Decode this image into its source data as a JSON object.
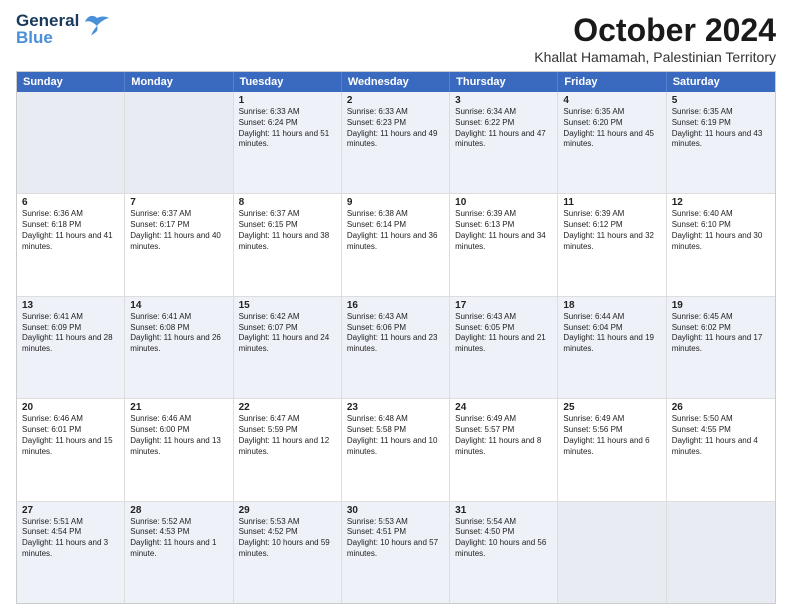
{
  "header": {
    "logo_line1": "General",
    "logo_line2": "Blue",
    "month": "October 2024",
    "location": "Khallat Hamamah, Palestinian Territory"
  },
  "weekdays": [
    "Sunday",
    "Monday",
    "Tuesday",
    "Wednesday",
    "Thursday",
    "Friday",
    "Saturday"
  ],
  "rows": [
    [
      {
        "day": "",
        "info": "",
        "empty": true
      },
      {
        "day": "",
        "info": "",
        "empty": true
      },
      {
        "day": "1",
        "info": "Sunrise: 6:33 AM\nSunset: 6:24 PM\nDaylight: 11 hours and 51 minutes."
      },
      {
        "day": "2",
        "info": "Sunrise: 6:33 AM\nSunset: 6:23 PM\nDaylight: 11 hours and 49 minutes."
      },
      {
        "day": "3",
        "info": "Sunrise: 6:34 AM\nSunset: 6:22 PM\nDaylight: 11 hours and 47 minutes."
      },
      {
        "day": "4",
        "info": "Sunrise: 6:35 AM\nSunset: 6:20 PM\nDaylight: 11 hours and 45 minutes."
      },
      {
        "day": "5",
        "info": "Sunrise: 6:35 AM\nSunset: 6:19 PM\nDaylight: 11 hours and 43 minutes."
      }
    ],
    [
      {
        "day": "6",
        "info": "Sunrise: 6:36 AM\nSunset: 6:18 PM\nDaylight: 11 hours and 41 minutes."
      },
      {
        "day": "7",
        "info": "Sunrise: 6:37 AM\nSunset: 6:17 PM\nDaylight: 11 hours and 40 minutes."
      },
      {
        "day": "8",
        "info": "Sunrise: 6:37 AM\nSunset: 6:15 PM\nDaylight: 11 hours and 38 minutes."
      },
      {
        "day": "9",
        "info": "Sunrise: 6:38 AM\nSunset: 6:14 PM\nDaylight: 11 hours and 36 minutes."
      },
      {
        "day": "10",
        "info": "Sunrise: 6:39 AM\nSunset: 6:13 PM\nDaylight: 11 hours and 34 minutes."
      },
      {
        "day": "11",
        "info": "Sunrise: 6:39 AM\nSunset: 6:12 PM\nDaylight: 11 hours and 32 minutes."
      },
      {
        "day": "12",
        "info": "Sunrise: 6:40 AM\nSunset: 6:10 PM\nDaylight: 11 hours and 30 minutes."
      }
    ],
    [
      {
        "day": "13",
        "info": "Sunrise: 6:41 AM\nSunset: 6:09 PM\nDaylight: 11 hours and 28 minutes."
      },
      {
        "day": "14",
        "info": "Sunrise: 6:41 AM\nSunset: 6:08 PM\nDaylight: 11 hours and 26 minutes."
      },
      {
        "day": "15",
        "info": "Sunrise: 6:42 AM\nSunset: 6:07 PM\nDaylight: 11 hours and 24 minutes."
      },
      {
        "day": "16",
        "info": "Sunrise: 6:43 AM\nSunset: 6:06 PM\nDaylight: 11 hours and 23 minutes."
      },
      {
        "day": "17",
        "info": "Sunrise: 6:43 AM\nSunset: 6:05 PM\nDaylight: 11 hours and 21 minutes."
      },
      {
        "day": "18",
        "info": "Sunrise: 6:44 AM\nSunset: 6:04 PM\nDaylight: 11 hours and 19 minutes."
      },
      {
        "day": "19",
        "info": "Sunrise: 6:45 AM\nSunset: 6:02 PM\nDaylight: 11 hours and 17 minutes."
      }
    ],
    [
      {
        "day": "20",
        "info": "Sunrise: 6:46 AM\nSunset: 6:01 PM\nDaylight: 11 hours and 15 minutes."
      },
      {
        "day": "21",
        "info": "Sunrise: 6:46 AM\nSunset: 6:00 PM\nDaylight: 11 hours and 13 minutes."
      },
      {
        "day": "22",
        "info": "Sunrise: 6:47 AM\nSunset: 5:59 PM\nDaylight: 11 hours and 12 minutes."
      },
      {
        "day": "23",
        "info": "Sunrise: 6:48 AM\nSunset: 5:58 PM\nDaylight: 11 hours and 10 minutes."
      },
      {
        "day": "24",
        "info": "Sunrise: 6:49 AM\nSunset: 5:57 PM\nDaylight: 11 hours and 8 minutes."
      },
      {
        "day": "25",
        "info": "Sunrise: 6:49 AM\nSunset: 5:56 PM\nDaylight: 11 hours and 6 minutes."
      },
      {
        "day": "26",
        "info": "Sunrise: 5:50 AM\nSunset: 4:55 PM\nDaylight: 11 hours and 4 minutes."
      }
    ],
    [
      {
        "day": "27",
        "info": "Sunrise: 5:51 AM\nSunset: 4:54 PM\nDaylight: 11 hours and 3 minutes."
      },
      {
        "day": "28",
        "info": "Sunrise: 5:52 AM\nSunset: 4:53 PM\nDaylight: 11 hours and 1 minute."
      },
      {
        "day": "29",
        "info": "Sunrise: 5:53 AM\nSunset: 4:52 PM\nDaylight: 10 hours and 59 minutes."
      },
      {
        "day": "30",
        "info": "Sunrise: 5:53 AM\nSunset: 4:51 PM\nDaylight: 10 hours and 57 minutes."
      },
      {
        "day": "31",
        "info": "Sunrise: 5:54 AM\nSunset: 4:50 PM\nDaylight: 10 hours and 56 minutes."
      },
      {
        "day": "",
        "info": "",
        "empty": true
      },
      {
        "day": "",
        "info": "",
        "empty": true
      }
    ]
  ],
  "alt_rows": [
    0,
    2,
    4
  ]
}
